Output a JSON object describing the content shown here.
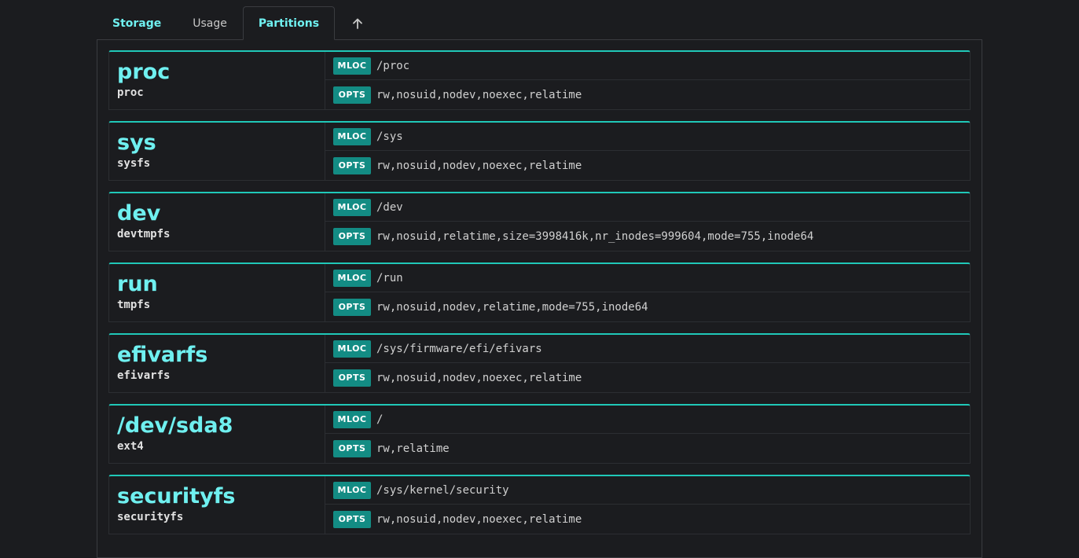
{
  "tabs": {
    "storage": "Storage",
    "usage": "Usage",
    "partitions": "Partitions"
  },
  "labels": {
    "mloc": "MLOC",
    "opts": "OPTS"
  },
  "colors": {
    "accent": "#6ff0f0",
    "badge": "#138c84",
    "card_top": "#20c8b8",
    "background": "#1b1c1f"
  },
  "partitions": [
    {
      "name": "proc",
      "type": "proc",
      "mloc": "/proc",
      "opts": "rw,nosuid,nodev,noexec,relatime"
    },
    {
      "name": "sys",
      "type": "sysfs",
      "mloc": "/sys",
      "opts": "rw,nosuid,nodev,noexec,relatime"
    },
    {
      "name": "dev",
      "type": "devtmpfs",
      "mloc": "/dev",
      "opts": "rw,nosuid,relatime,size=3998416k,nr_inodes=999604,mode=755,inode64"
    },
    {
      "name": "run",
      "type": "tmpfs",
      "mloc": "/run",
      "opts": "rw,nosuid,nodev,relatime,mode=755,inode64"
    },
    {
      "name": "efivarfs",
      "type": "efivarfs",
      "mloc": "/sys/firmware/efi/efivars",
      "opts": "rw,nosuid,nodev,noexec,relatime"
    },
    {
      "name": "/dev/sda8",
      "type": "ext4",
      "mloc": "/",
      "opts": "rw,relatime"
    },
    {
      "name": "securityfs",
      "type": "securityfs",
      "mloc": "/sys/kernel/security",
      "opts": "rw,nosuid,nodev,noexec,relatime"
    }
  ]
}
